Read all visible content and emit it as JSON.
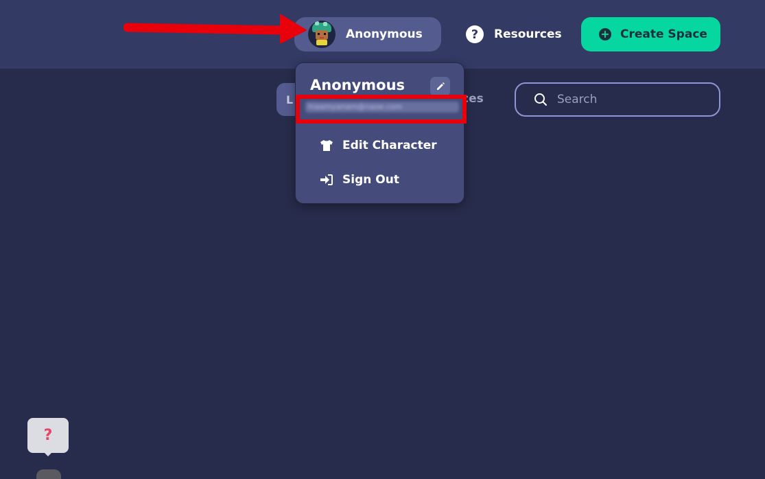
{
  "header": {
    "user_name": "Anonymous",
    "resources_label": "Resources",
    "create_space_label": "Create Space"
  },
  "tabs": {
    "first_partial": "L",
    "second_partial": "ces"
  },
  "search": {
    "placeholder": "Search"
  },
  "dropdown": {
    "name": "Anonymous",
    "email_blurred": "hiaamyanam@naoe.com",
    "items": [
      {
        "label": "Edit Character",
        "icon": "shirt-icon"
      },
      {
        "label": "Sign Out",
        "icon": "sign-out-icon"
      }
    ]
  },
  "help_bubble": {
    "label": "?"
  },
  "colors": {
    "background": "#282c4c",
    "topbar": "#333a64",
    "accent": "#06d6a0",
    "annotation": "#e8000b"
  }
}
